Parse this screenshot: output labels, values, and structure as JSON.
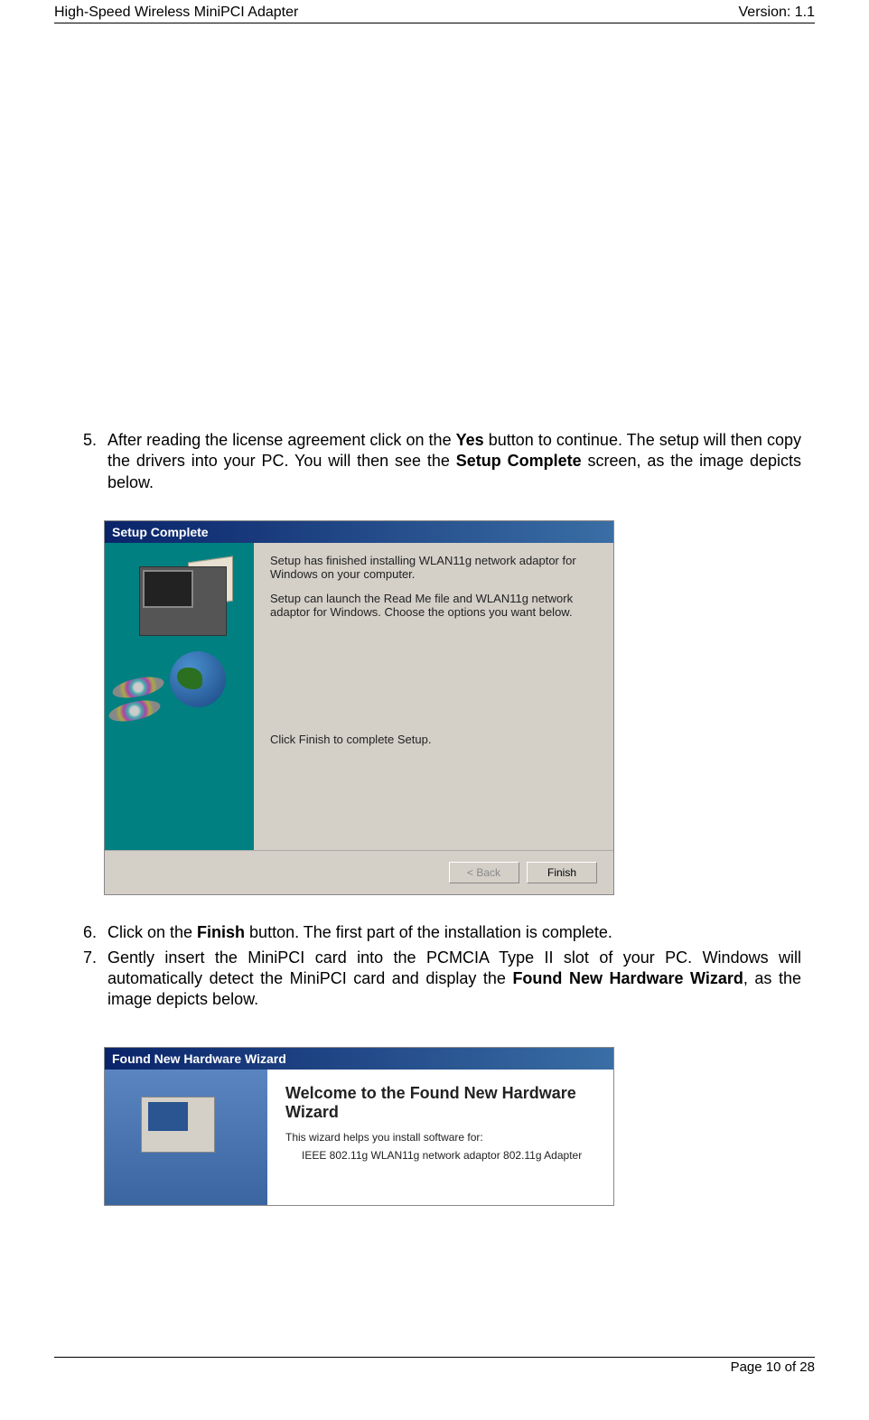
{
  "header": {
    "left": "High-Speed Wireless MiniPCI Adapter",
    "right": "Version: 1.1"
  },
  "items": {
    "item5": {
      "num": "5.",
      "a": "After reading the license agreement click on the ",
      "b": "Yes",
      "c": " button to continue. The setup will then copy the drivers into your PC. You will then see the ",
      "d": "Setup Complete",
      "e": " screen, as the image depicts below."
    },
    "item6": {
      "num": "6.",
      "a": "Click on the ",
      "b": "Finish",
      "c": " button.  The first part of the installation is complete."
    },
    "item7": {
      "num": "7.",
      "a": "Gently insert the MiniPCI card into the PCMCIA Type II slot of your PC.  Windows will automatically detect the MiniPCI card and display the ",
      "b": "Found New Hardware Wizard",
      "c": ", as the image depicts below."
    }
  },
  "dialog1": {
    "title": "Setup Complete",
    "p1": "Setup has finished installing WLAN11g network adaptor for Windows on your computer.",
    "p2": "Setup can launch the Read Me file and WLAN11g network adaptor for Windows.  Choose the options you want below.",
    "p3": "Click Finish to complete Setup.",
    "back": "< Back",
    "finish": "Finish"
  },
  "dialog2": {
    "title": "Found New Hardware Wizard",
    "heading": "Welcome to the Found New Hardware Wizard",
    "p1": "This wizard helps you install software for:",
    "p2": "IEEE 802.11g WLAN11g network adaptor 802.11g Adapter"
  },
  "footer": {
    "page": "Page 10 of 28"
  }
}
